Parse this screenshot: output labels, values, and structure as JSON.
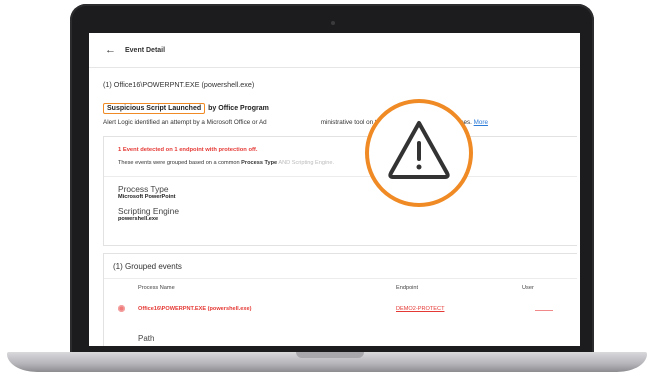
{
  "app": {
    "title": "Event Detail",
    "back_icon": "back-arrow-icon"
  },
  "event": {
    "process_header": "(1) Office16\\POWERPNT.EXE (powershell.exe)",
    "alert_title_highlight": "Suspicious Script Launched",
    "alert_title_rest": "by Office Program",
    "description": "Alert Logic identified an attempt by a Microsoft Office or Ad",
    "description_tail": "ministrative tool on the system for malicious purposes.",
    "more_link": "More"
  },
  "summary": {
    "detected": "1 Event detected on 1 endpoint with protection off.",
    "grouped_prefix": "These events were grouped based on a common",
    "grouped_bold": "Process Type",
    "grouped_faded": "AND Scripting Engine."
  },
  "properties": [
    {
      "label": "Process Type",
      "value": "Microsoft PowerPoint"
    },
    {
      "label": "Scripting Engine",
      "value": "powershell.exe"
    }
  ],
  "grouped_events": {
    "title": "(1) Grouped events",
    "columns": {
      "process": "Process Name",
      "endpoint": "Endpoint",
      "user": "User"
    },
    "rows": [
      {
        "process": "Office16\\POWERPNT.EXE (powershell.exe)",
        "endpoint": "DEMO2-PROTECT"
      }
    ],
    "path_label": "Path"
  },
  "overlay": {
    "icon": "warning-triangle-icon",
    "ring_color": "#f08a24",
    "symbol_color": "#333333"
  },
  "colors": {
    "accent_orange": "#f08a24",
    "alert_red": "#e53935",
    "link_blue": "#2a7ad8"
  }
}
